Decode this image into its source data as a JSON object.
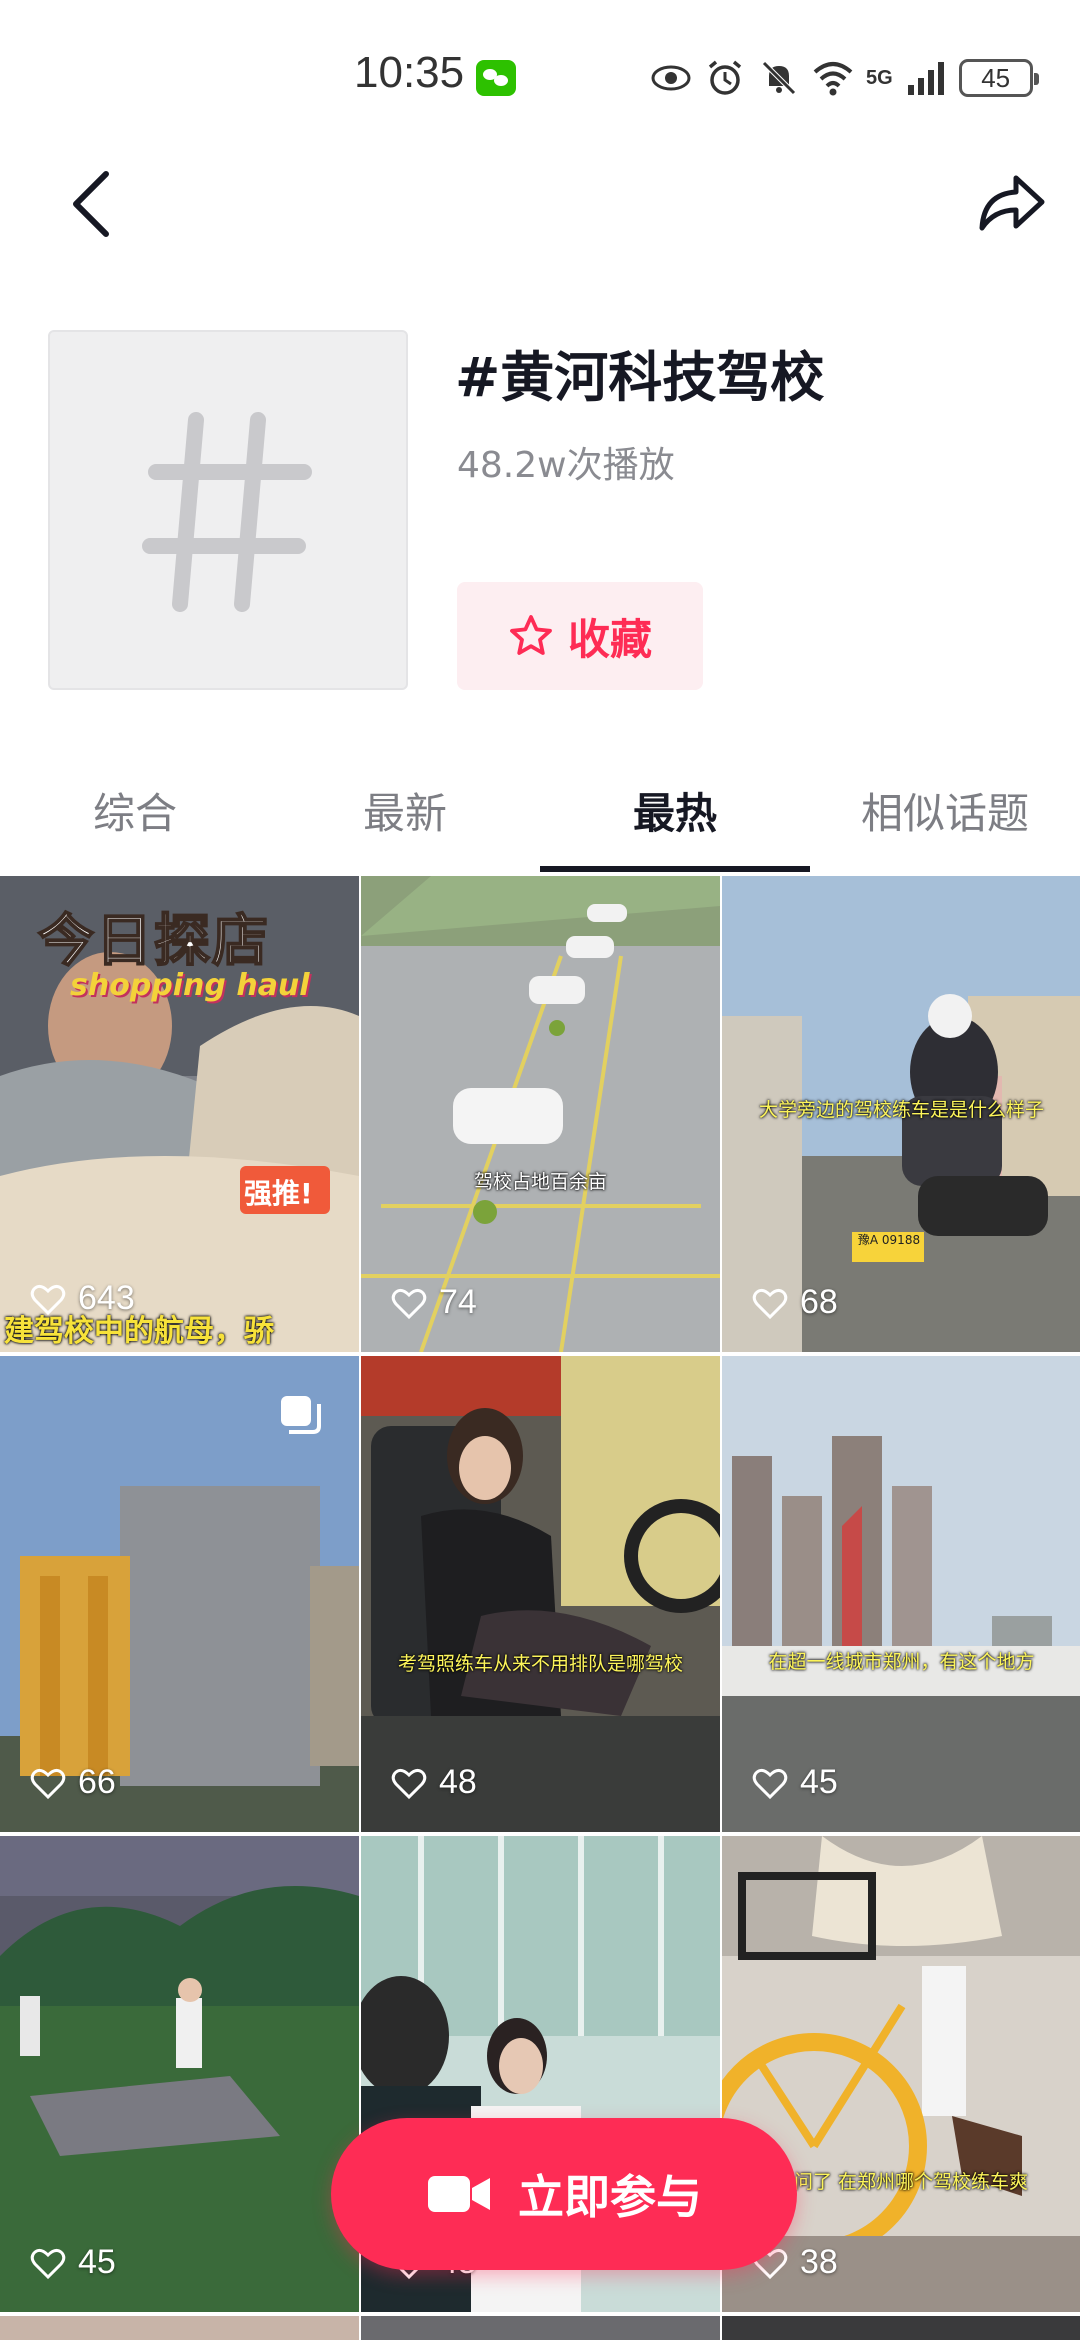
{
  "status_bar": {
    "time": "10:35",
    "network": "5G",
    "battery": "45",
    "icons": [
      "wechat-icon",
      "eye-icon",
      "alarm-icon",
      "mute-bell-icon",
      "wifi-icon",
      "signal-icon",
      "battery-icon"
    ]
  },
  "header": {
    "back_icon": "back-chevron-icon",
    "share_icon": "share-arrow-icon"
  },
  "topic": {
    "title": "#黄河科技驾校",
    "plays": "48.2w次播放",
    "favorite_label": "收藏",
    "favorite_icon": "star-outline-icon"
  },
  "tabs": [
    {
      "label": "综合",
      "active": false
    },
    {
      "label": "最新",
      "active": false
    },
    {
      "label": "最热",
      "active": true
    },
    {
      "label": "相似话题",
      "active": false
    }
  ],
  "videos": [
    {
      "likes": "643",
      "overlay_title": "今日探店",
      "overlay_sub": "shopping haul",
      "badge": "强推!",
      "caption": "建驾校中的航母，骄"
    },
    {
      "likes": "74",
      "caption": "驾校占地百余亩"
    },
    {
      "likes": "68",
      "caption": "大学旁边的驾校练车是是什么样子",
      "plate": "豫A 09188"
    },
    {
      "likes": "66",
      "multi_image": true
    },
    {
      "likes": "48",
      "caption": "考驾照练车从来不用排队是哪驾校"
    },
    {
      "likes": "45",
      "caption": "在超一线城市郑州，有这个地方"
    },
    {
      "likes": "45"
    },
    {
      "likes": "45"
    },
    {
      "likes": "38",
      "caption": "请问了 在郑州哪个驾校练车爽"
    }
  ],
  "join_button": {
    "label": "立即参与",
    "icon": "video-camera-icon"
  },
  "colors": {
    "accent": "#fe2c55",
    "favorite_bg": "#fdeef1",
    "text_primary": "#161823",
    "text_secondary": "#8a8b91"
  }
}
